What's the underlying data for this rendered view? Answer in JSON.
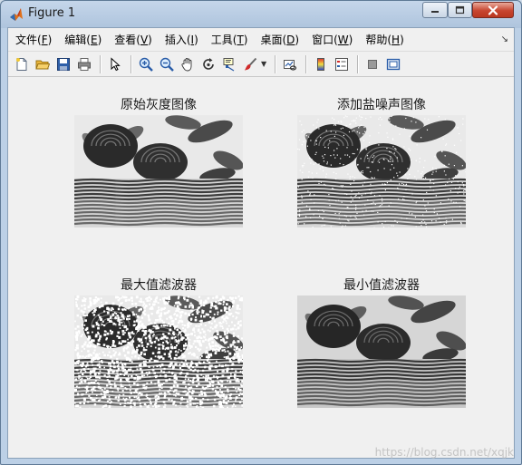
{
  "window": {
    "title": "Figure 1"
  },
  "menu": [
    {
      "text": "文件(",
      "key": "F",
      "end": ")"
    },
    {
      "text": "编辑(",
      "key": "E",
      "end": ")"
    },
    {
      "text": "查看(",
      "key": "V",
      "end": ")"
    },
    {
      "text": "插入(",
      "key": "I",
      "end": ")"
    },
    {
      "text": "工具(",
      "key": "T",
      "end": ")"
    },
    {
      "text": "桌面(",
      "key": "D",
      "end": ")"
    },
    {
      "text": "窗口(",
      "key": "W",
      "end": ")"
    },
    {
      "text": "帮助(",
      "key": "H",
      "end": ")"
    }
  ],
  "toolbar": [
    "new-figure-icon",
    "open-folder-icon",
    "save-icon",
    "print-icon",
    "select-arrow-icon",
    "zoom-in-icon",
    "zoom-out-icon",
    "pan-hand-icon",
    "rotate-3d-icon",
    "data-cursor-icon",
    "brush-icon",
    "link-plot-icon",
    "colorbar-icon",
    "legend-icon",
    "hide-plot-tools-icon",
    "show-plot-tools-icon"
  ],
  "plots": [
    {
      "title": "原始灰度图像",
      "noise": "none"
    },
    {
      "title": "添加盐噪声图像",
      "noise": "salt"
    },
    {
      "title": "最大值滤波器",
      "noise": "max"
    },
    {
      "title": "最小值滤波器",
      "noise": "min"
    }
  ],
  "watermark": "https://blog.csdn.net/xqjk"
}
